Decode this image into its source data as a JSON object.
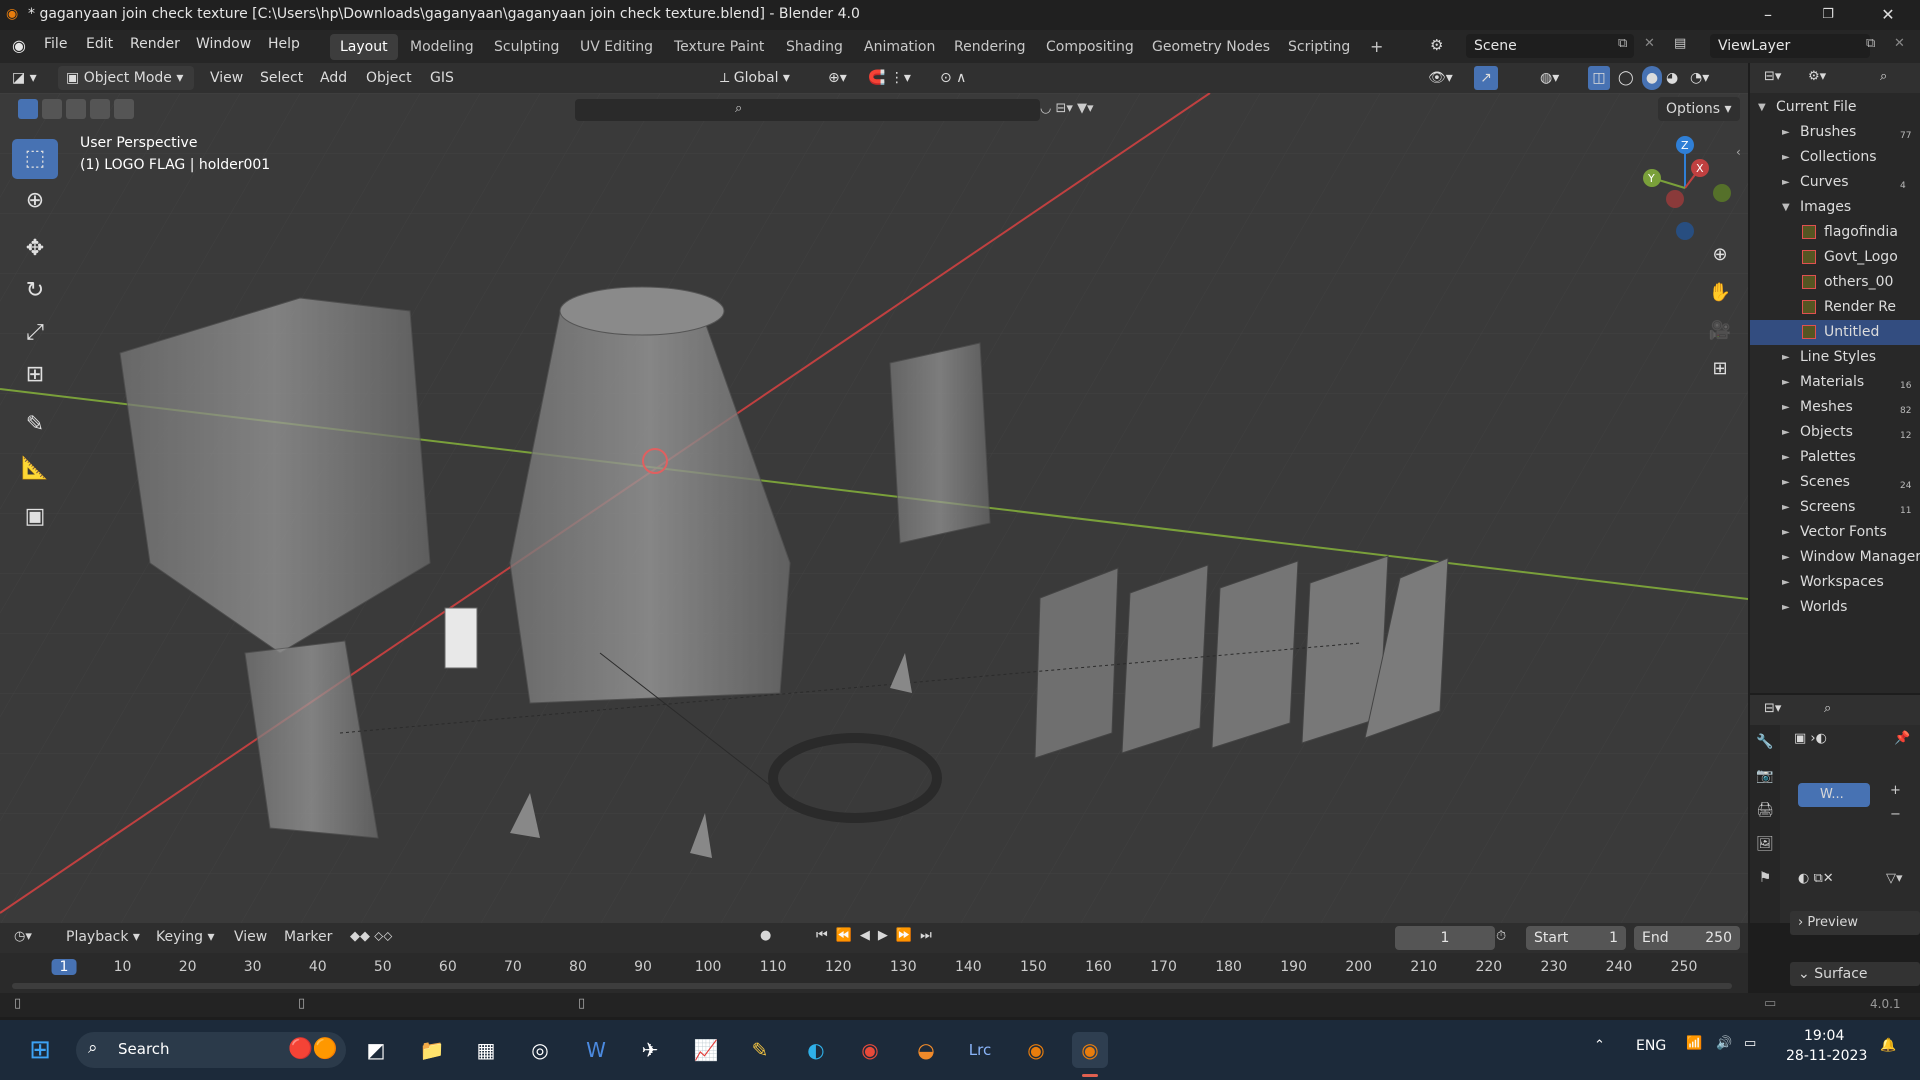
{
  "titlebar": {
    "title": "* gaganyaan join check texture [C:\\Users\\hp\\Downloads\\gaganyaan\\gaganyaan join check texture.blend] - Blender 4.0",
    "minimize": "–",
    "maximize": "❐",
    "close": "✕"
  },
  "menu": {
    "file": "File",
    "edit": "Edit",
    "render": "Render",
    "window": "Window",
    "help": "Help"
  },
  "workspaces": [
    "Layout",
    "Modeling",
    "Sculpting",
    "UV Editing",
    "Texture Paint",
    "Shading",
    "Animation",
    "Rendering",
    "Compositing",
    "Geometry Nodes",
    "Scripting"
  ],
  "workspace_add": "+",
  "scene": {
    "name": "Scene",
    "view_layer": "ViewLayer"
  },
  "viewport_header": {
    "mode": "Object Mode",
    "view": "View",
    "select": "Select",
    "add": "Add",
    "object": "Object",
    "gis": "GIS",
    "orientation": "Global",
    "options": "Options"
  },
  "viewport": {
    "perspective": "User Perspective",
    "active_object": "(1) LOGO FLAG | holder001",
    "gizmo": {
      "x": "X",
      "y": "Y",
      "z": "Z"
    }
  },
  "outliner": {
    "root": "Current File",
    "items": [
      {
        "label": "Brushes",
        "count": "77",
        "expanded": false
      },
      {
        "label": "Collections",
        "count": "",
        "expanded": false
      },
      {
        "label": "Curves",
        "count": "4",
        "expanded": false
      },
      {
        "label": "Images",
        "count": "",
        "expanded": true
      },
      {
        "label": "flagofindia",
        "child": true
      },
      {
        "label": "Govt_Logo",
        "child": true
      },
      {
        "label": "others_00",
        "child": true
      },
      {
        "label": "Render Re",
        "child": true
      },
      {
        "label": "Untitled",
        "child": true,
        "selected": true
      },
      {
        "label": "Line Styles",
        "count": "",
        "expanded": false
      },
      {
        "label": "Materials",
        "count": "16",
        "expanded": false
      },
      {
        "label": "Meshes",
        "count": "82",
        "expanded": false
      },
      {
        "label": "Objects",
        "count": "12",
        "expanded": false
      },
      {
        "label": "Palettes",
        "count": "",
        "expanded": false
      },
      {
        "label": "Scenes",
        "count": "24",
        "expanded": false
      },
      {
        "label": "Screens",
        "count": "11",
        "expanded": false
      },
      {
        "label": "Vector Fonts",
        "count": "",
        "expanded": false
      },
      {
        "label": "Window Managers",
        "count": "",
        "expanded": false
      },
      {
        "label": "Workspaces",
        "count": "",
        "expanded": false
      },
      {
        "label": "Worlds",
        "count": "",
        "expanded": false
      }
    ]
  },
  "properties": {
    "world_slot": "W...",
    "preview": "Preview",
    "surface": "Surface"
  },
  "timeline": {
    "playback": "Playback",
    "keying": "Keying",
    "view": "View",
    "marker": "Marker",
    "current_frame": "1",
    "start_label": "Start",
    "start": "1",
    "end_label": "End",
    "end": "250",
    "ticks": [
      "1",
      "10",
      "20",
      "30",
      "40",
      "50",
      "60",
      "70",
      "80",
      "90",
      "100",
      "110",
      "120",
      "130",
      "140",
      "150",
      "160",
      "170",
      "180",
      "190",
      "200",
      "210",
      "220",
      "230",
      "240",
      "250"
    ]
  },
  "statusbar": {
    "version": "4.0.1"
  },
  "taskbar": {
    "search": "Search",
    "language": "ENG",
    "time": "19:04",
    "date": "28-11-2023",
    "apps": [
      "explorer-icon",
      "calculator-icon",
      "obs-icon",
      "word-icon",
      "app-icon",
      "stocks-icon",
      "notes-icon",
      "edge-icon",
      "chrome-icon",
      "photo-icon",
      "lightroom-icon",
      "blender-icon",
      "blender-active-icon"
    ],
    "lightroom_label": "Lrc"
  },
  "colors": {
    "accent": "#4772b3",
    "x_axis": "#c04040",
    "y_axis": "#7aa03a",
    "z_axis": "#2f7fd6"
  }
}
